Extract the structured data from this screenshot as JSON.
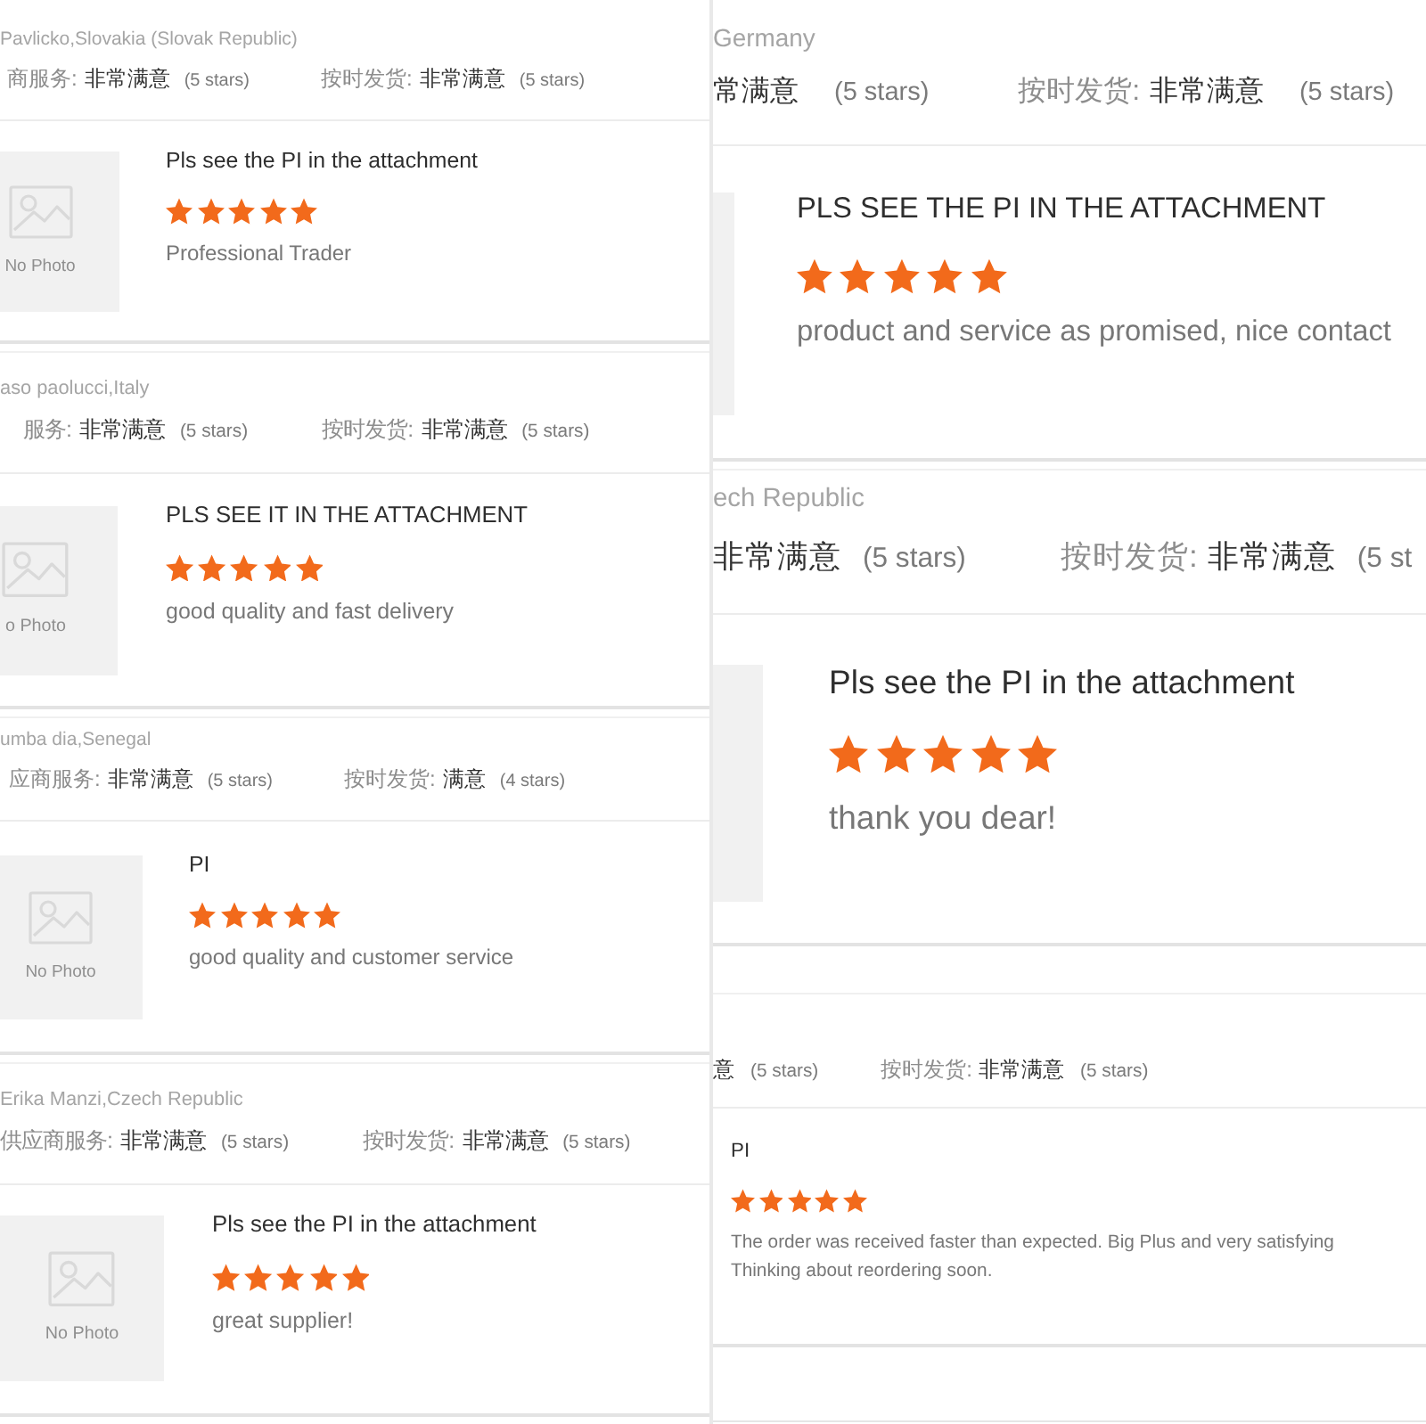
{
  "columns": [
    {
      "panels": [
        {
          "buyer": "Pavlicko,Slovakia (Slovak Republic)",
          "ratings": [
            {
              "label": "商服务:",
              "value": "非常满意",
              "count": "(5 stars)"
            },
            {
              "label": "按时发货:",
              "value": "非常满意",
              "count": "(5 stars)"
            }
          ],
          "review": {
            "photo": {
              "kind": "full",
              "caption": "No Photo"
            },
            "title": "Pls see the PI in the attachment",
            "stars": 5,
            "comment": "Professional Trader"
          }
        },
        {
          "buyer": "aso paolucci,Italy",
          "ratings": [
            {
              "label": "服务:",
              "value": "非常满意",
              "count": "(5 stars)"
            },
            {
              "label": "按时发货:",
              "value": "非常满意",
              "count": "(5 stars)"
            }
          ],
          "review": {
            "photo": {
              "kind": "full",
              "caption": "o Photo"
            },
            "title": "PLS SEE IT IN THE ATTACHMENT",
            "stars": 5,
            "comment": "good quality and fast delivery"
          }
        },
        {
          "buyer": "umba dia,Senegal",
          "ratings": [
            {
              "label": "应商服务:",
              "value": "非常满意",
              "count": "(5 stars)"
            },
            {
              "label": "按时发货:",
              "value": "满意",
              "count": "(4 stars)"
            }
          ],
          "review": {
            "photo": {
              "kind": "full",
              "caption": "No Photo"
            },
            "title": "PI",
            "stars": 5,
            "comment": "good quality and customer service"
          }
        },
        {
          "buyer": "Erika Manzi,Czech Republic",
          "ratings": [
            {
              "label": "供应商服务:",
              "value": "非常满意",
              "count": "(5 stars)"
            },
            {
              "label": "按时发货:",
              "value": "非常满意",
              "count": "(5 stars)"
            }
          ],
          "review": {
            "photo": {
              "kind": "full",
              "caption": "No Photo"
            },
            "title": "Pls see the PI in the attachment",
            "stars": 5,
            "comment": "great supplier!"
          }
        }
      ]
    },
    {
      "panels": [
        {
          "buyer": "Germany",
          "ratings": [
            {
              "value": "常满意",
              "count": "(5 stars)"
            },
            {
              "label": "按时发货:",
              "value": "非常满意",
              "count": "(5 stars)"
            }
          ],
          "review": {
            "photo": {
              "kind": "edge"
            },
            "title": "PLS SEE THE PI IN THE ATTACHMENT",
            "stars": 5,
            "comment": "product and service as promised, nice contact"
          }
        },
        {
          "buyer": "ech Republic",
          "ratings": [
            {
              "value": "非常满意",
              "count": "(5 stars)"
            },
            {
              "label": "按时发货:",
              "value": "非常满意",
              "count": "(5 st"
            }
          ],
          "review": {
            "photo": {
              "kind": "edge"
            },
            "title": "Pls see the PI in the attachment",
            "stars": 5,
            "comment": "thank you dear!"
          }
        },
        {
          "ratings": [
            {
              "value": "意",
              "count": "(5 stars)"
            },
            {
              "label": "按时发货:",
              "value": "非常满意",
              "count": "(5 stars)"
            }
          ],
          "review": {
            "title": "PI",
            "stars": 5,
            "comment": "The order was received faster than expected. Big Plus and very satisfying\nThinking about reordering soon."
          }
        }
      ]
    }
  ]
}
